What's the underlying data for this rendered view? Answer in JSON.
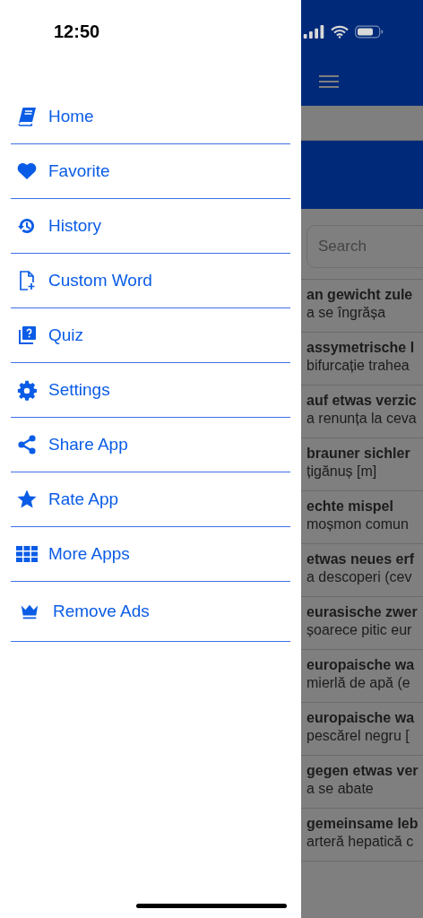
{
  "status_bar": {
    "time": "12:50"
  },
  "drawer": {
    "items": [
      {
        "label": "Home",
        "kind": "book"
      },
      {
        "label": "Favorite",
        "kind": "heart"
      },
      {
        "label": "History",
        "kind": "history"
      },
      {
        "label": "Custom Word",
        "kind": "file-plus"
      },
      {
        "label": "Quiz",
        "kind": "quiz"
      },
      {
        "label": "Settings",
        "kind": "gear"
      },
      {
        "label": "Share App",
        "kind": "share"
      },
      {
        "label": "Rate App",
        "kind": "star"
      },
      {
        "label": "More Apps",
        "kind": "grid"
      },
      {
        "label": "Remove Ads",
        "kind": "crown"
      }
    ]
  },
  "background": {
    "search": {
      "placeholder": "Search"
    },
    "entries": [
      {
        "term": "an gewicht zule",
        "translation": "a se îngrășa"
      },
      {
        "term": "assymetrische l",
        "translation": "bifurcație trahea"
      },
      {
        "term": "auf etwas verzic",
        "translation": "a renunța la ceva"
      },
      {
        "term": "brauner sichler",
        "translation": "țigănuș [m]"
      },
      {
        "term": "echte mispel",
        "translation": "moșmon comun"
      },
      {
        "term": "etwas neues erf",
        "translation": "a descoperi (cev"
      },
      {
        "term": "eurasische zwer",
        "translation": "șoarece pitic eur"
      },
      {
        "term": "europaische wa",
        "translation": "mierlă de apă (e"
      },
      {
        "term": "europaische wa",
        "translation": "pescărel negru ["
      },
      {
        "term": "gegen etwas ver",
        "translation": "a se abate"
      },
      {
        "term": "gemeinsame leb",
        "translation": "arteră hepatică c"
      }
    ]
  }
}
